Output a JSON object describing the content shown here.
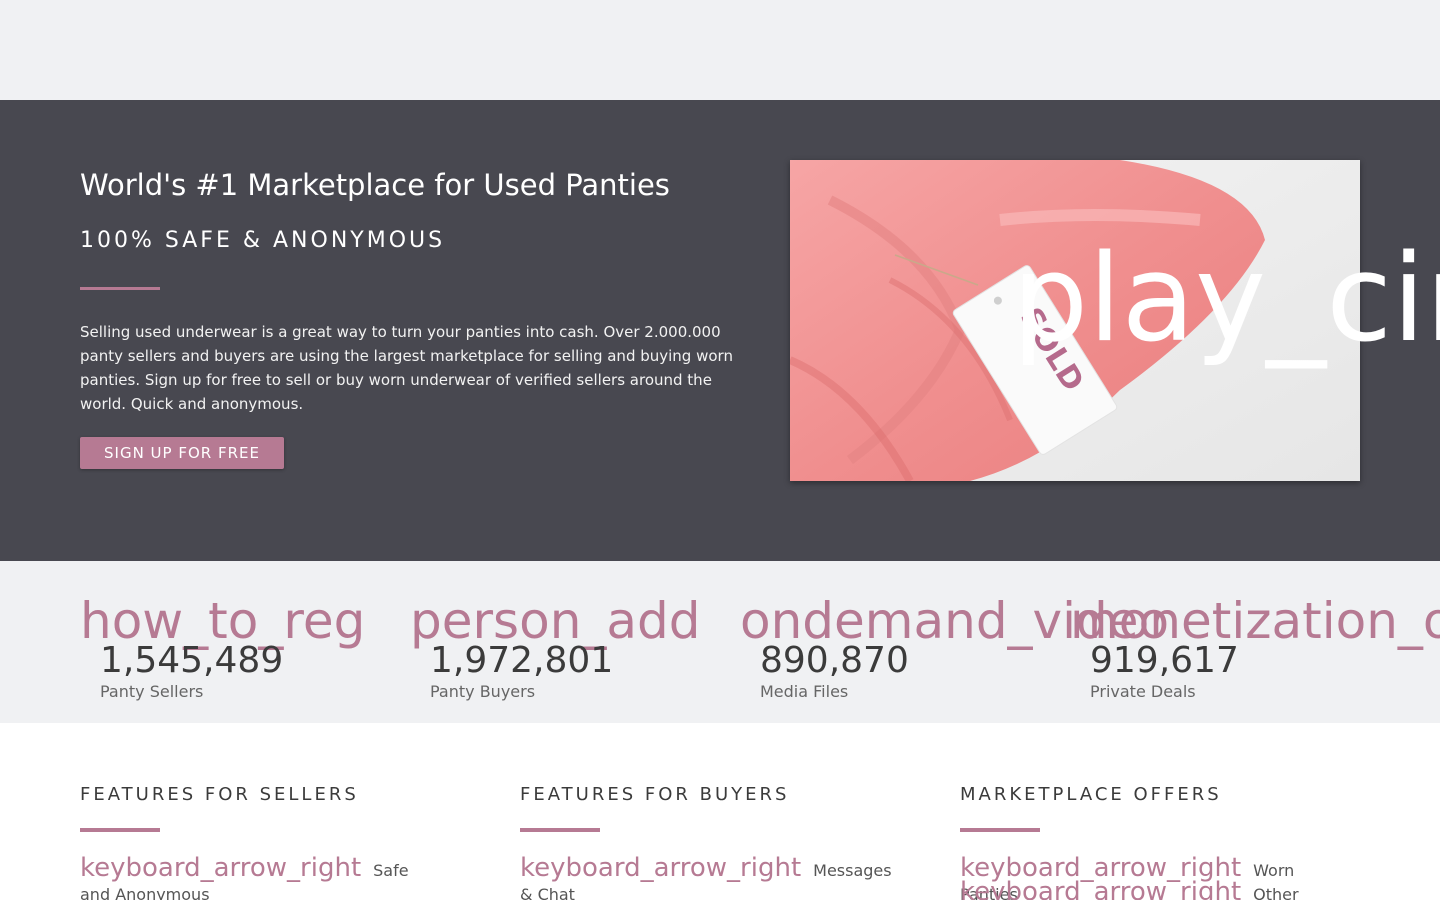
{
  "hero": {
    "title": "World's #1 Marketplace for Used Panties",
    "subtitle": "100% SAFE & ANONYMOUS",
    "description": "Selling used underwear is a great way to turn your panties into cash. Over 2.000.000 panty sellers and buyers are using the largest marketplace for selling and buying worn panties. Sign up for free to sell or buy worn underwear of verified sellers around the world. Quick and anonymous.",
    "signup_label": "SIGN UP FOR FREE",
    "video_icon": "play_circle",
    "image_tag_text": "SOLD"
  },
  "stats": [
    {
      "icon": "how_to_reg",
      "value": "1,545,489",
      "label": "Panty Sellers"
    },
    {
      "icon": "person_add",
      "value": "1,972,801",
      "label": "Panty Buyers"
    },
    {
      "icon": "ondemand_video",
      "value": "890,870",
      "label": "Media Files"
    },
    {
      "icon": "monetization_on",
      "value": "919,617",
      "label": "Private Deals"
    }
  ],
  "features": {
    "sellers": {
      "heading": "FEATURES FOR SELLERS",
      "items": [
        {
          "icon": "keyboard_arrow_right",
          "label": "Safe and Anonymous"
        }
      ]
    },
    "buyers": {
      "heading": "FEATURES FOR BUYERS",
      "items": [
        {
          "icon": "keyboard_arrow_right",
          "label": "Messages & Chat"
        }
      ]
    },
    "offers": {
      "heading": "MARKETPLACE OFFERS",
      "items": [
        {
          "icon": "keyboard_arrow_right",
          "label": "Worn Panties"
        },
        {
          "icon": "keyboard_arrow_right",
          "label": "Other Worn"
        }
      ]
    }
  },
  "colors": {
    "accent": "#b67a93",
    "hero_bg": "#484850",
    "page_bg": "#f0f1f3"
  }
}
